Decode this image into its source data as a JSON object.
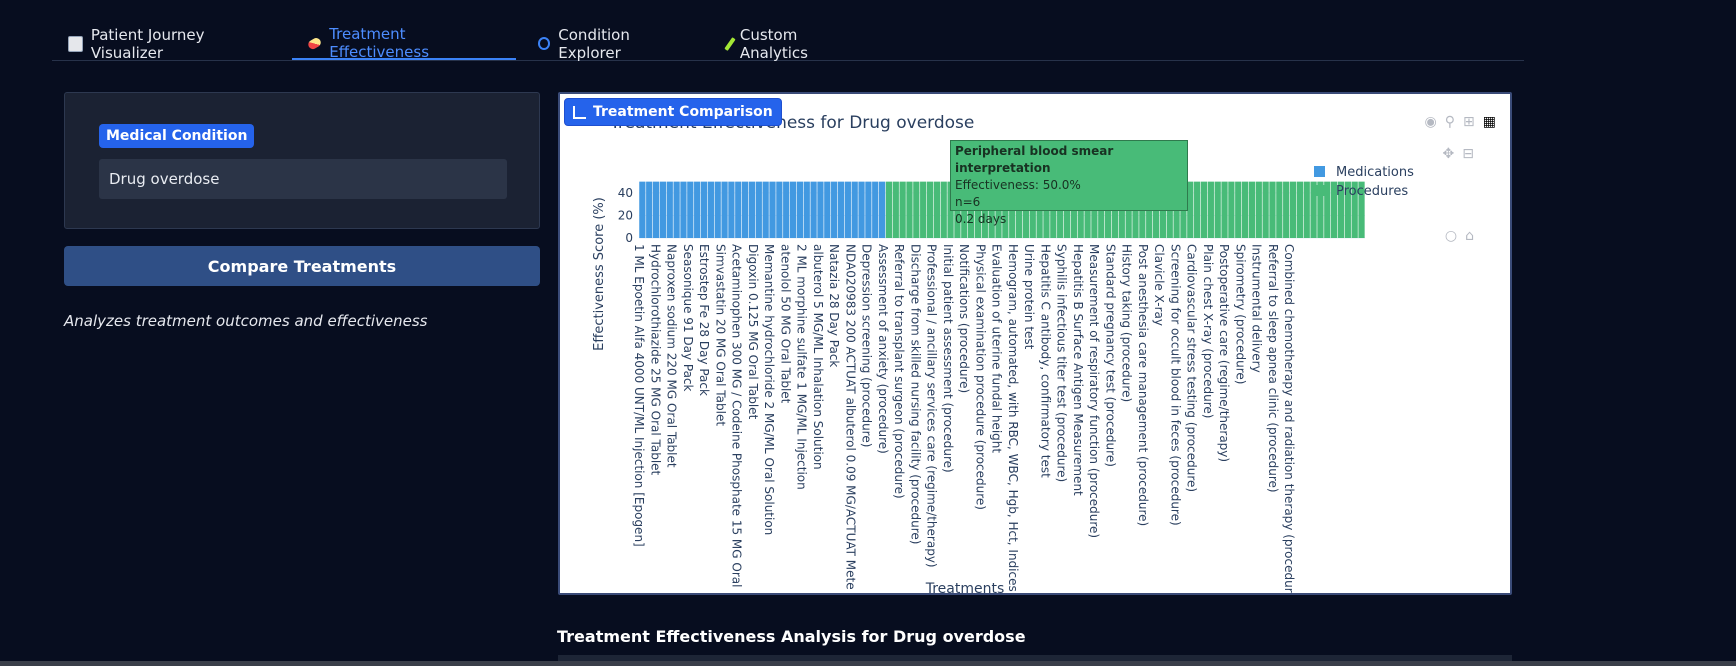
{
  "tabs": [
    {
      "label": "Patient Journey Visualizer",
      "icon": "chart-icon",
      "color": "#9aa6b8"
    },
    {
      "label": "Treatment Effectiveness",
      "icon": "pill-icon",
      "color": "#ef4444"
    },
    {
      "label": "Condition Explorer",
      "icon": "magnifier-icon",
      "color": "#3b82f6"
    },
    {
      "label": "Custom Analytics",
      "icon": "pencil-icon",
      "color": "#a3e635"
    }
  ],
  "active_tab": "Treatment Effectiveness",
  "condition": {
    "label": "Medical Condition",
    "value": "Drug overdose"
  },
  "compare_button": "Compare Treatments",
  "description": "Analyzes treatment outcomes and effectiveness",
  "plot_badge": "Treatment Comparison",
  "analysis_title": "Treatment Effectiveness Analysis for Drug overdose",
  "tooltip": {
    "title": "Peripheral blood smear interpretation",
    "line1": "Effectiveness: 50.0%",
    "line2": "n=6",
    "line3": "0.2 days"
  },
  "chart_data": {
    "type": "bar",
    "title": "Treatment Effectiveness for Drug overdose",
    "xlabel": "Treatments",
    "ylabel": "Effectiveness Score (%)",
    "yticks": [
      0,
      20,
      40
    ],
    "ylim": [
      0,
      55
    ],
    "legend_position": "right",
    "series": [
      {
        "name": "Medications",
        "color": "#4299e1",
        "bar_count": 36,
        "value": 50
      },
      {
        "name": "Procedures",
        "color": "#48bb78",
        "bar_count": 70,
        "value": 50
      }
    ],
    "tick_labels": [
      "1 ML Epoetin Alfa 4000 UNT/ML Injection [Epogen]",
      "Hydrochlorothiazide 25 MG Oral Tablet",
      "Naproxen sodium 220 MG Oral Tablet",
      "Seasonique 91 Day Pack",
      "Estrostep Fe 28 Day Pack",
      "Simvastatin 20 MG Oral Tablet",
      "Acetaminophen 300 MG / Codeine Phosphate 15 MG Oral",
      "Digoxin 0.125 MG Oral Tablet",
      "Memantine hydrochloride 2 MG/ML Oral Solution",
      "atenolol 50 MG Oral Tablet",
      "2 ML morphine sulfate 1 MG/ML Injection",
      "albuterol 5 MG/ML Inhalation Solution",
      "Natazia 28 Day Pack",
      "NDA020983 200 ACTUAT albuterol 0.09 MG/ACTUAT Mete",
      "Depression screening (procedure)",
      "Assessment of anxiety (procedure)",
      "Referral to transplant surgeon (procedure)",
      "Discharge from skilled nursing facility (procedure)",
      "Professional / ancillary services care (regime/therapy)",
      "Initial patient assessment (procedure)",
      "Notifications (procedure)",
      "Physical examination procedure (procedure)",
      "Evaluation of uterine fundal height",
      "Hemogram, automated, with RBC, WBC, Hgb, Hct, Indices",
      "Urine protein test",
      "Hepatitis C antibody, confirmatory test",
      "Syphilis infectious titer test (procedure)",
      "Hepatitis B Surface Antigen Measurement",
      "Measurement of respiratory function (procedure)",
      "Standard pregnancy test (procedure)",
      "History taking (procedure)",
      "Post anesthesia care management (procedure)",
      "Clavicle X-ray",
      "Screening for occult blood in feces (procedure)",
      "Cardiovascular stress testing (procedure)",
      "Plain chest X-ray (procedure)",
      "Postoperative care (regime/therapy)",
      "Spirometry (procedure)",
      "Instrumental delivery",
      "Referral to sleep apnea clinic (procedure)",
      "Combined chemotherapy and radiation therapy (procedure)"
    ]
  }
}
